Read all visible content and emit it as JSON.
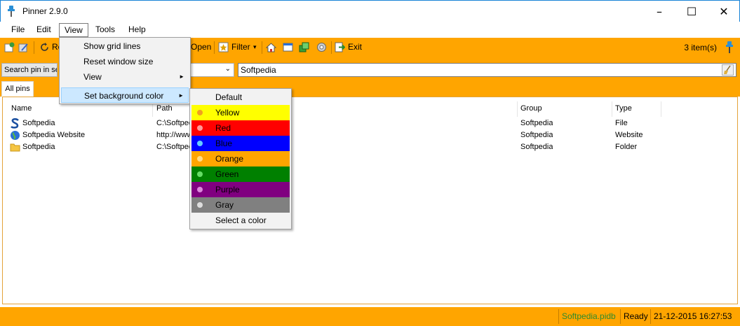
{
  "window": {
    "title": "Pinner 2.9.0",
    "minimize": "–",
    "maximize": "☐",
    "close": "✕"
  },
  "menu": {
    "file": "File",
    "edit": "Edit",
    "view": "View",
    "tools": "Tools",
    "help": "Help"
  },
  "toolbar": {
    "open": "Open",
    "filter": "Filter",
    "filter_arrow": "▾",
    "exit": "Exit",
    "count": "3 item(s)",
    "refresh_partial": "Re"
  },
  "search": {
    "label": "Search pin in selected",
    "value": "Softpedia",
    "combo_arrow": "⌄"
  },
  "tabs": [
    {
      "label": "All pins"
    }
  ],
  "columns": {
    "name": "Name",
    "path": "Path",
    "group": "Group",
    "type": "Type"
  },
  "rows": [
    {
      "name": "Softpedia",
      "path": "C:\\Softpedia",
      "group": "Softpedia",
      "type": "File"
    },
    {
      "name": "Softpedia Website",
      "path": "http://www.softpedia.com",
      "group": "Softpedia",
      "type": "Website"
    },
    {
      "name": "Softpedia",
      "path": "C:\\Softpedia",
      "group": "Softpedia",
      "type": "Folder"
    }
  ],
  "status": {
    "file": "Softpedia.pidb",
    "state": "Ready",
    "datetime": "21-12-2015 16:27:53"
  },
  "view_menu": {
    "items": [
      {
        "label": "Show grid lines"
      },
      {
        "label": "Reset window size"
      },
      {
        "label": "View",
        "arrow": "►"
      },
      {
        "label": "Set background color",
        "arrow": "►"
      }
    ]
  },
  "color_menu": {
    "items": [
      {
        "label": "Default",
        "bg": "#f2f2f2",
        "dot": ""
      },
      {
        "label": "Yellow",
        "bg": "#ffff00",
        "dot": "#f0a020"
      },
      {
        "label": "Red",
        "bg": "#ff0000",
        "dot": "#ff9999"
      },
      {
        "label": "Blue",
        "bg": "#0000ff",
        "dot": "#66ccff"
      },
      {
        "label": "Orange",
        "bg": "#ffa500",
        "dot": "#ffdd88"
      },
      {
        "label": "Green",
        "bg": "#008000",
        "dot": "#66dd66"
      },
      {
        "label": "Purple",
        "bg": "#800080",
        "dot": "#dd88dd"
      },
      {
        "label": "Gray",
        "bg": "#808080",
        "dot": "#dddddd"
      },
      {
        "label": "Select a color",
        "bg": "#f2f2f2",
        "dot": ""
      }
    ]
  },
  "colors": {
    "accent": "#ffa500",
    "status_file": "#2e8b2e"
  }
}
